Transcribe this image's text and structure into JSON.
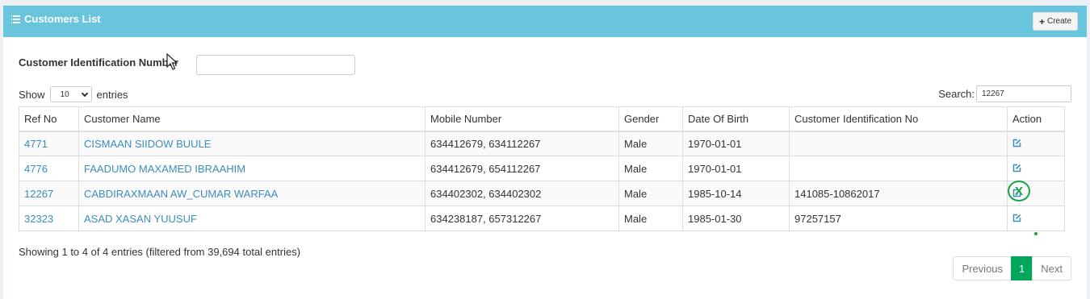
{
  "header": {
    "title": "Customers List",
    "create_label": "Create"
  },
  "filter": {
    "label": "Customer Identification Number",
    "value": ""
  },
  "length": {
    "show_label": "Show",
    "value": "10",
    "entries_label": "entries"
  },
  "search": {
    "label": "Search:",
    "value": "12267"
  },
  "table": {
    "columns": [
      "Ref No",
      "Customer Name",
      "Mobile Number",
      "Gender",
      "Date Of Birth",
      "Customer Identification No",
      "Action"
    ],
    "rows": [
      {
        "ref": "4771",
        "name": "CISMAAN SIIDOW BUULE",
        "mobile": "634412679, 634112267",
        "gender": "Male",
        "dob": "1970-01-01",
        "cid": ""
      },
      {
        "ref": "4776",
        "name": "FAADUMO MAXAMED IBRAAHIM",
        "mobile": "634412679, 654112267",
        "gender": "Male",
        "dob": "1970-01-01",
        "cid": ""
      },
      {
        "ref": "12267",
        "name": "CABDIRAXMAAN AW_CUMAR WARFAA",
        "mobile": "634402302, 634402302",
        "gender": "Male",
        "dob": "1985-10-14",
        "cid": "141085-10862017"
      },
      {
        "ref": "32323",
        "name": "ASAD XASAN YUUSUF",
        "mobile": "634238187, 657312267",
        "gender": "Male",
        "dob": "1985-01-30",
        "cid": "97257157"
      }
    ]
  },
  "marker_label": "X",
  "info": "Showing 1 to 4 of 4 entries (filtered from 39,694 total entries)",
  "pagination": {
    "previous": "Previous",
    "current": "1",
    "next": "Next"
  },
  "colors": {
    "header_bg": "#69c4de",
    "link": "#3c8dbc",
    "active_page": "#00a65a",
    "marker": "#1aa34a"
  }
}
